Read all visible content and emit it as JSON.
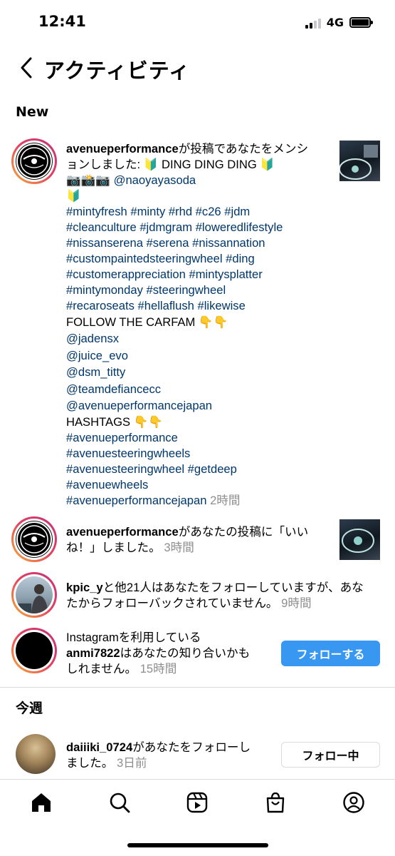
{
  "status": {
    "time": "12:41",
    "network": "4G"
  },
  "header": {
    "title": "アクティビティ"
  },
  "sections": {
    "new": "New",
    "this_week": "今週"
  },
  "notifications": [
    {
      "user": "avenueperformance",
      "lines": [
        "が投稿であなたをメンシ",
        "ョンしました: 🔰 DING DING DING 🔰",
        "📷📸📷 @naoyayasoda",
        "🔰"
      ],
      "tags": [
        "#mintyfresh #minty #rhd #c26 #jdm",
        "#cleanculture #jdmgram #loweredlifestyle",
        "#nissanserena #serena #nissannation",
        "#custompaintedsteeringwheel #ding",
        "#customerappreciation #mintysplatter",
        "#mintymonday #steeringwheel",
        "#recaroseats #hellaflush #likewise"
      ],
      "follow_label": "FOLLOW THE  CARFAM 👇👇",
      "mentions": [
        "@jadensx",
        "@juice_evo",
        "@dsm_titty",
        "@teamdefiancecc",
        "@avenueperformancejapan"
      ],
      "hashtags_label": "HASHTAGS 👇👇",
      "hashtags": [
        "#avenueperformance",
        "#avenuesteeringwheels",
        "#avenuesteeringwheel #getdeep",
        "#avenuewheels",
        "#avenueperformancejapan"
      ],
      "time": "2時間"
    },
    {
      "user": "avenueperformance",
      "line1": "があなたの投稿に「いい",
      "line2": "ね！」しました。",
      "time": "3時間"
    },
    {
      "user": "kpic_y",
      "line1": "と他21人はあなたをフォローしていますが、あな",
      "line2": "たからフォローバックされていません。",
      "time": "9時間"
    },
    {
      "line0": "Instagramを利用している",
      "user": "anmi7822",
      "line1": "はあなたの知り合いかも",
      "line2": "しれません。",
      "time": "15時間",
      "button": "フォローする"
    },
    {
      "user": "daiiiki_0724",
      "line1": "があなたをフォローし",
      "line2": "ました。",
      "time": "3日前",
      "button": "フォロー中"
    }
  ],
  "tabs": [
    "home-icon",
    "search-icon",
    "reels-icon",
    "shop-icon",
    "profile-icon"
  ]
}
